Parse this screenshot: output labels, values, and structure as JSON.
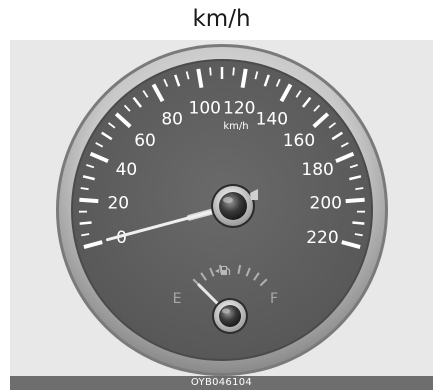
{
  "header": {
    "title": "km/h"
  },
  "speedometer": {
    "unit_label": "km/h",
    "scale_labels": [
      "0",
      "20",
      "40",
      "60",
      "80",
      "100",
      "120",
      "140",
      "160",
      "180",
      "200",
      "220"
    ],
    "current_speed": 0
  },
  "fuel_gauge": {
    "empty_label": "E",
    "full_label": "F",
    "icon": "fuel-pump-icon",
    "level": 0
  },
  "footer": {
    "code": "OYB046104"
  },
  "colors": {
    "panel_background": "#e8e8e8",
    "dial_face": "#606060",
    "dial_bezel": "#d0d0d0",
    "marking": "#ffffff",
    "fuel_marking": "#b0b0b0",
    "footer_background": "#6e6e6e"
  }
}
